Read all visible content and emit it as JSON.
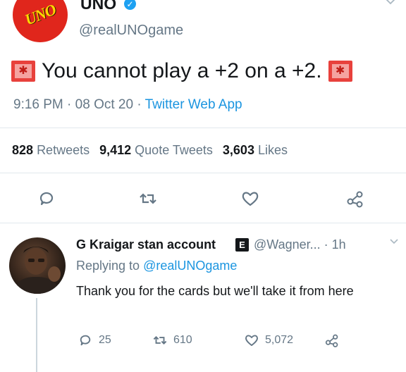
{
  "tweet": {
    "logo_text": "UNO",
    "author_name": "UNO",
    "verified_mark": "✓",
    "handle": "@realUNOgame",
    "text": "You cannot play a +2 on a +2.",
    "time": "9:16 PM",
    "separator": "·",
    "date": "08 Oct 20",
    "source": "Twitter Web App",
    "stats": {
      "retweets_count": "828",
      "retweets_label": "Retweets",
      "quote_count": "9,412",
      "quote_label": "Quote Tweets",
      "likes_count": "3,603",
      "likes_label": "Likes"
    },
    "icons": [
      "reply-icon",
      "retweet-icon",
      "like-icon",
      "share-icon",
      "chevron-down-icon",
      "siren-emoji"
    ]
  },
  "reply": {
    "author_name": "G Kraigar stan account",
    "badge": "E",
    "handle": "@Wagner...",
    "time": "· 1h",
    "replying_prefix": "Replying to",
    "replying_to": "@realUNOgame",
    "text": "Thank you for the cards but we'll take it from here",
    "reply_count": "25",
    "retweet_count": "610",
    "like_count": "5,072"
  },
  "colors": {
    "accent": "#1b95e0",
    "muted": "#657786",
    "uno_red": "#e0261c",
    "uno_yellow": "#ffd900"
  }
}
